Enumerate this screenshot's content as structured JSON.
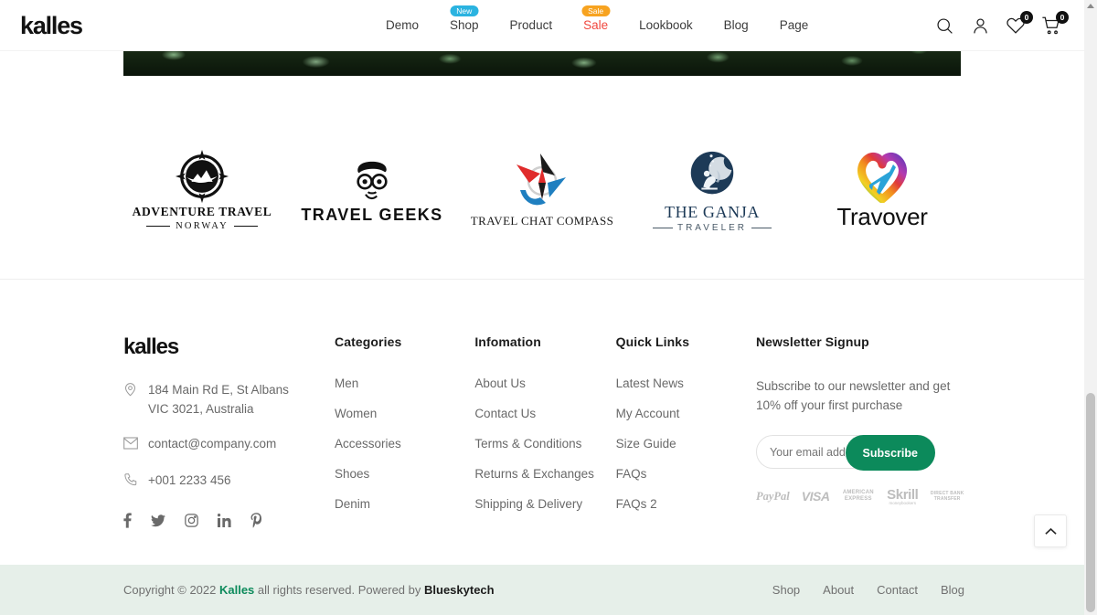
{
  "header": {
    "logo": "kalles",
    "nav": [
      {
        "label": "Demo",
        "badge": null,
        "sale": false
      },
      {
        "label": "Shop",
        "badge": "New",
        "badge_type": "new",
        "sale": false
      },
      {
        "label": "Product",
        "badge": null,
        "sale": false
      },
      {
        "label": "Sale",
        "badge": "Sale",
        "badge_type": "sale",
        "sale": true
      },
      {
        "label": "Lookbook",
        "badge": null,
        "sale": false
      },
      {
        "label": "Blog",
        "badge": null,
        "sale": false
      },
      {
        "label": "Page",
        "badge": null,
        "sale": false
      }
    ],
    "icons": {
      "search": "search-icon",
      "account": "user-icon",
      "wishlist": "heart-icon",
      "wishlist_count": "0",
      "cart": "cart-icon",
      "cart_count": "0"
    }
  },
  "brands": [
    {
      "name": "ADVENTURE TRAVEL",
      "sub": "NORWAY",
      "icon": "compass-mountain-logo"
    },
    {
      "name": "TRAVEL GEEKS",
      "sub": "",
      "icon": "geek-face-glasses-logo"
    },
    {
      "name": "TRAVEL CHAT COMPASS",
      "sub": "",
      "icon": "compass-star-logo"
    },
    {
      "name": "THE GANJA",
      "sub": "TRAVELER",
      "icon": "moon-sitting-person-logo"
    },
    {
      "name": "Travover",
      "sub": "",
      "icon": "heart-plane-rainbow-logo"
    }
  ],
  "footer": {
    "logo": "kalles",
    "address_line1": "184 Main Rd E, St Albans",
    "address_line2": "VIC 3021, Australia",
    "email": "contact@company.com",
    "phone": "+001 2233 456",
    "socials": [
      "facebook-icon",
      "twitter-icon",
      "instagram-icon",
      "linkedin-icon",
      "pinterest-icon"
    ],
    "columns": [
      {
        "title": "Categories",
        "links": [
          "Men",
          "Women",
          "Accessories",
          "Shoes",
          "Denim"
        ]
      },
      {
        "title": "Infomation",
        "links": [
          "About Us",
          "Contact Us",
          "Terms & Conditions",
          "Returns & Exchanges",
          "Shipping & Delivery"
        ]
      },
      {
        "title": "Quick Links",
        "links": [
          "Latest News",
          "My Account",
          "Size Guide",
          "FAQs",
          "FAQs 2"
        ]
      }
    ],
    "newsletter": {
      "title": "Newsletter Signup",
      "text_line1": "Subscribe to our newsletter and get",
      "text_line2": "10% off your first purchase",
      "placeholder": "Your email address",
      "value": "",
      "button": "Subscribe"
    },
    "payments": [
      {
        "name": "PayPal",
        "kind": "paypal"
      },
      {
        "name": "VISA",
        "kind": "visa"
      },
      {
        "name": "AMERICAN EXPRESS",
        "kind": "amex"
      },
      {
        "name": "Skrill",
        "sub": "moneybookers",
        "kind": "skrill"
      },
      {
        "name": "DIRECT BANK TRANSFER",
        "kind": "bank"
      }
    ]
  },
  "bottom": {
    "copyright_pre": "Copyright © 2022 ",
    "copyright_brand": "Kalles",
    "copyright_mid": " all rights reserved. Powered by ",
    "copyright_by": "Blueskytech",
    "links": [
      "Shop",
      "About",
      "Contact",
      "Blog"
    ]
  },
  "controls": {
    "scroll_top": "chevron-up-icon"
  },
  "colors": {
    "accent_green": "#0c8a5b",
    "badge_new": "#2bb3e0",
    "badge_sale": "#f7a320",
    "sale_text": "#f0473e",
    "bottom_bar_bg": "#e6efe9"
  }
}
